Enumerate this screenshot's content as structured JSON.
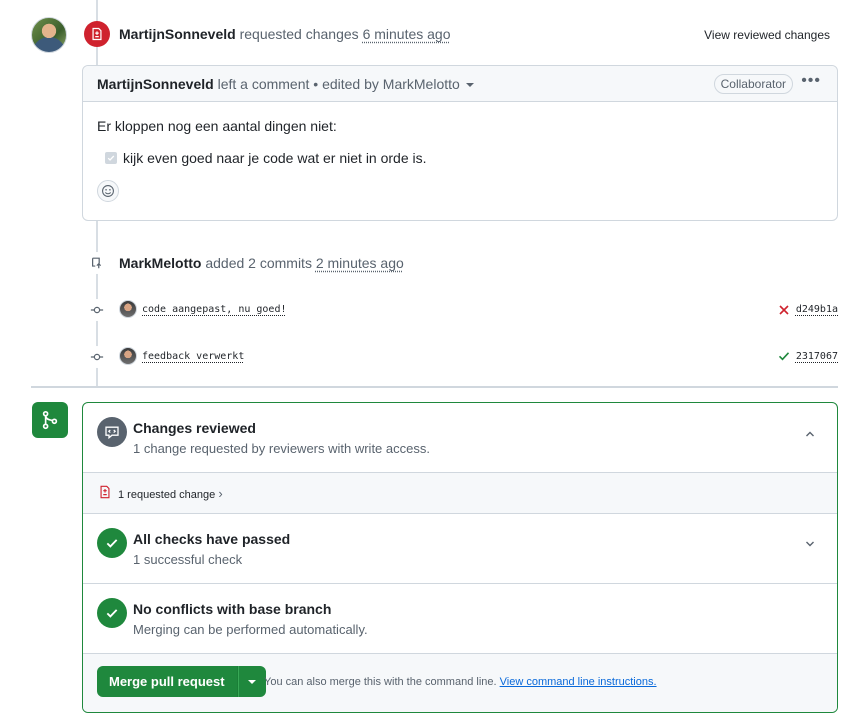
{
  "review": {
    "author": "MartijnSonneveld",
    "action": "requested changes",
    "time": "6 minutes ago",
    "view_reviewed": "View reviewed changes"
  },
  "comment": {
    "author": "MartijnSonneveld",
    "meta": "left a comment • edited by MarkMelotto",
    "role": "Collaborator",
    "body": "Er kloppen nog een aantal dingen niet:",
    "task": "kijk even goed naar je code wat er niet in orde is.",
    "task_checked": true
  },
  "commits_event": {
    "author": "MarkMelotto",
    "action": "added 2 commits",
    "time": "2 minutes ago"
  },
  "commits": [
    {
      "message": "code aangepast, nu goed!",
      "status": "failure",
      "sha": "d249b1a"
    },
    {
      "message": "feedback verwerkt",
      "status": "success",
      "sha": "2317067"
    }
  ],
  "merge": {
    "reviewed_title": "Changes reviewed",
    "reviewed_sub": "1 change requested by reviewers with write access.",
    "requested_change": "1 requested change",
    "checks_title": "All checks have passed",
    "checks_sub": "1 successful check",
    "conflicts_title": "No conflicts with base branch",
    "conflicts_sub": "Merging can be performed automatically.",
    "merge_button": "Merge pull request",
    "hint": "You can also merge this with the command line.",
    "hint_link": "View command line instructions."
  },
  "colors": {
    "success": "#1f883d",
    "danger": "#cf222e",
    "neutral": "#59636e"
  }
}
